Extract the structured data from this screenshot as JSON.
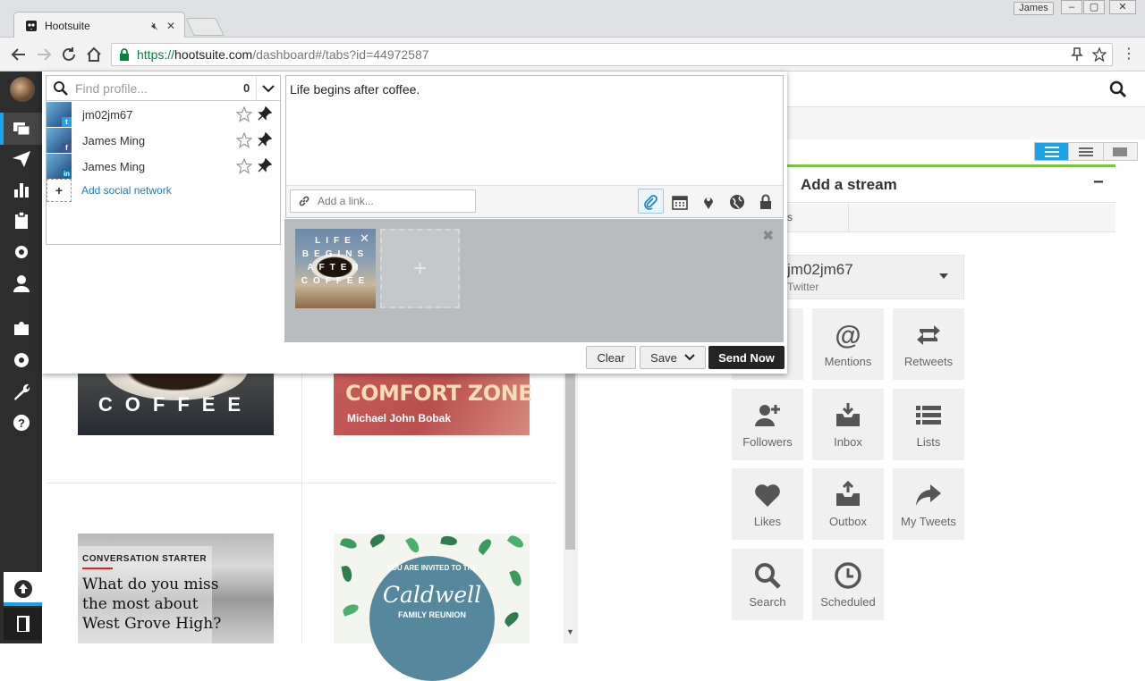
{
  "browser": {
    "tab_title": "Hootsuite",
    "url_protocol": "https://",
    "url_host": "hootsuite.com",
    "url_path": "/dashboard#/tabs?id=44972587",
    "user_badge": "James"
  },
  "composer": {
    "search_placeholder": "Find profile...",
    "selected_count": "0",
    "profiles": [
      {
        "name": "jm02jm67",
        "network": "twitter",
        "network_color": "#1da1f2"
      },
      {
        "name": "James Ming",
        "network": "facebook",
        "network_color": "#3b5998"
      },
      {
        "name": "James Ming",
        "network": "linkedin",
        "network_color": "#0077b5"
      }
    ],
    "add_network_label": "Add social network",
    "message": "Life begins after coffee.",
    "link_placeholder": "Add a link...",
    "thumbnail_text": "LIFE BEGINS AFTER COFFEE",
    "clear_label": "Clear",
    "save_label": "Save",
    "send_label": "Send Now"
  },
  "add_stream": {
    "title": "Add a stream",
    "minimize": "−",
    "partial_tab": "s",
    "account_name": "jm02jm67",
    "account_network": "Twitter",
    "stream_types": [
      {
        "label": "Mentions",
        "icon": "at-icon"
      },
      {
        "label": "Retweets",
        "icon": "retweet-icon"
      },
      {
        "label": "Followers",
        "icon": "add-user-icon"
      },
      {
        "label": "Inbox",
        "icon": "inbox-icon"
      },
      {
        "label": "Lists",
        "icon": "list-icon"
      },
      {
        "label": "Likes",
        "icon": "heart-icon"
      },
      {
        "label": "Outbox",
        "icon": "outbox-icon"
      },
      {
        "label": "My Tweets",
        "icon": "share-arrow-icon"
      },
      {
        "label": "Search",
        "icon": "search-icon"
      },
      {
        "label": "Scheduled",
        "icon": "clock-icon"
      }
    ]
  },
  "content_cards": {
    "coffee_text": "COFFEE",
    "comfort_title": "COMFORT ZONE",
    "comfort_author": "Michael John Bobak",
    "convo_tag": "CONVERSATION STARTER",
    "convo_question": "What do you miss the most about West Grove High?",
    "invite_text": "YOU ARE INVITED TO THE",
    "invite_name": "Caldwell",
    "invite_event": "FAMILY REUNION"
  },
  "colors": {
    "accent": "#1aa3e8",
    "rail": "#2d2d2d",
    "stream_green": "#7fc241",
    "send_button": "#252525"
  }
}
